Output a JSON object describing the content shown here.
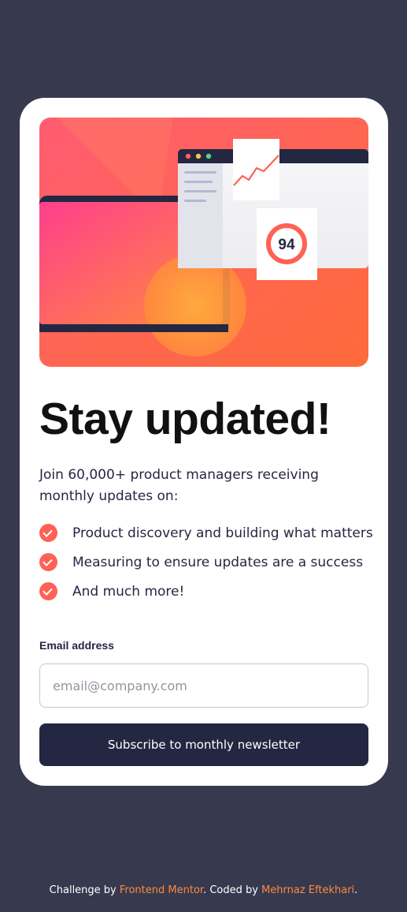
{
  "hero": {
    "score": "94"
  },
  "main": {
    "title": "Stay updated!",
    "intro": "Join 60,000+ product managers receiving monthly updates on:",
    "features": [
      "Product discovery and building what matters",
      "Measuring to ensure updates are a success",
      "And much more!"
    ]
  },
  "form": {
    "email_label": "Email address",
    "email_placeholder": "email@company.com",
    "email_value": "",
    "submit_label": "Subscribe to monthly newsletter"
  },
  "footer": {
    "challenge_prefix": "Challenge by ",
    "challenge_link": "Frontend Mentor",
    "coded_prefix": ". Coded by ",
    "author_link": "Mehrnaz Eftekhari",
    "suffix": "."
  },
  "colors": {
    "page_background": "#373a4f",
    "card_background": "#ffffff",
    "accent": "#ff6155",
    "button": "#242742",
    "link": "#ff8a3d",
    "hero_gradient_start": "#ff527b",
    "hero_gradient_end": "#ff6a3a"
  },
  "icons": {
    "bullet": "check-circle-icon"
  }
}
